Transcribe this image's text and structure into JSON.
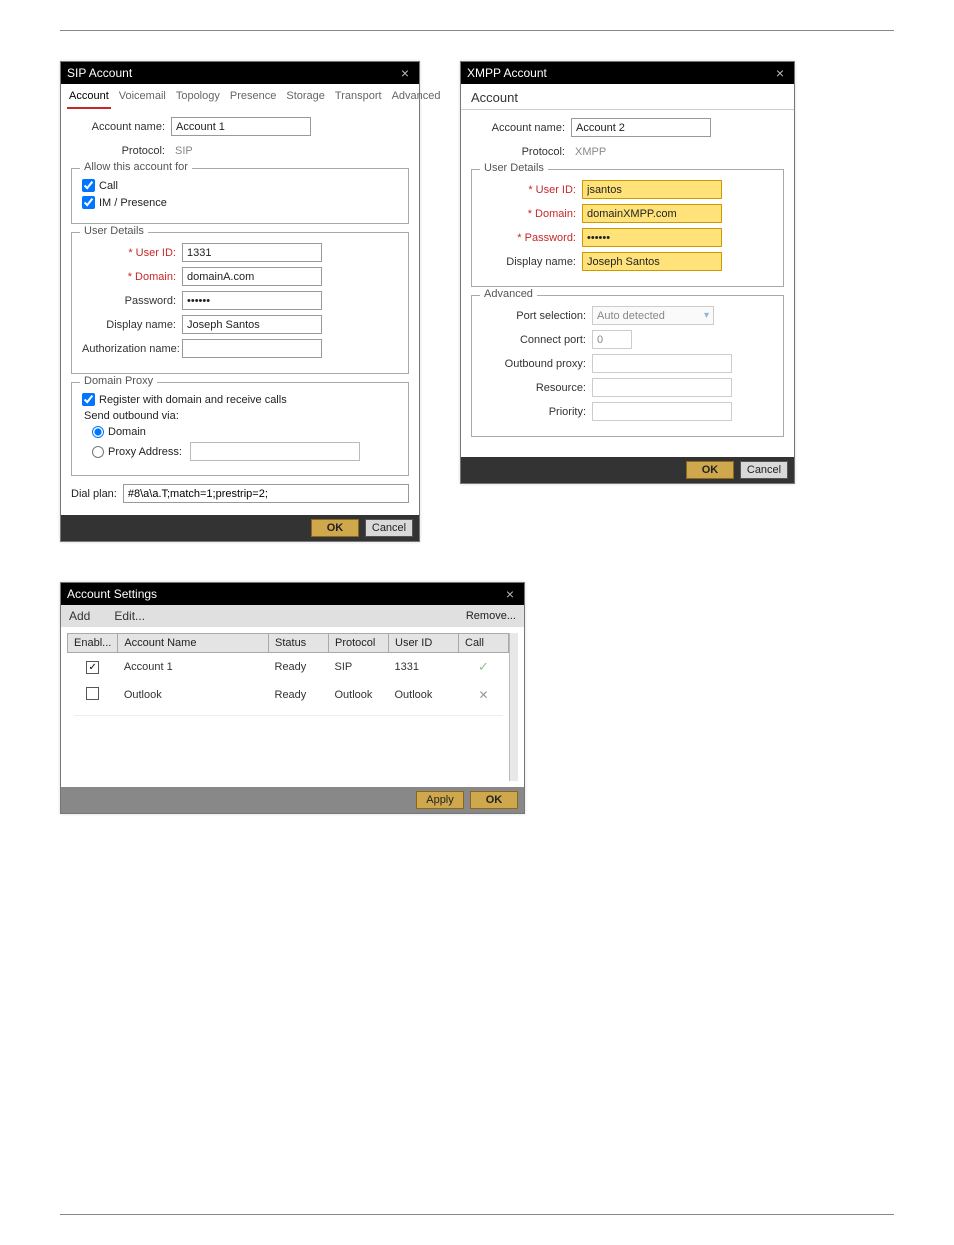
{
  "sip": {
    "title": "SIP Account",
    "tabs": [
      "Account",
      "Voicemail",
      "Topology",
      "Presence",
      "Storage",
      "Transport",
      "Advanced"
    ],
    "account_name_label": "Account name:",
    "account_name": "Account 1",
    "protocol_label": "Protocol:",
    "protocol": "SIP",
    "allow_group": "Allow this account for",
    "allow_call": "Call",
    "allow_im": "IM / Presence",
    "user_details_group": "User Details",
    "user_id_label": "* User ID:",
    "user_id": "1331",
    "domain_label": "* Domain:",
    "domain": "domainA.com",
    "password_label": "Password:",
    "password": "••••••",
    "display_name_label": "Display name:",
    "display_name": "Joseph Santos",
    "auth_name_label": "Authorization name:",
    "auth_name": "",
    "domain_proxy_group": "Domain Proxy",
    "register_label": "Register with domain and receive calls",
    "send_via_label": "Send outbound via:",
    "radio_domain": "Domain",
    "radio_proxy": "Proxy  Address:",
    "dial_plan_label": "Dial plan:",
    "dial_plan": "#8\\a\\a.T;match=1;prestrip=2;",
    "ok": "OK",
    "cancel": "Cancel"
  },
  "xmpp": {
    "title": "XMPP Account",
    "tab": "Account",
    "account_name_label": "Account name:",
    "account_name": "Account 2",
    "protocol_label": "Protocol:",
    "protocol": "XMPP",
    "user_details_group": "User Details",
    "user_id_label": "* User ID:",
    "user_id": "jsantos",
    "domain_label": "* Domain:",
    "domain": "domainXMPP.com",
    "password_label": "* Password:",
    "password": "••••••",
    "display_name_label": "Display name:",
    "display_name": "Joseph Santos",
    "advanced_group": "Advanced",
    "port_selection_label": "Port selection:",
    "port_selection": "Auto detected",
    "connect_port_label": "Connect port:",
    "connect_port": "0",
    "outbound_proxy_label": "Outbound proxy:",
    "resource_label": "Resource:",
    "priority_label": "Priority:",
    "ok": "OK",
    "cancel": "Cancel"
  },
  "accounts": {
    "title": "Account Settings",
    "menu_add": "Add",
    "menu_edit": "Edit...",
    "menu_remove": "Remove...",
    "col_enabled": "Enabl...",
    "col_name": "Account Name",
    "col_status": "Status",
    "col_protocol": "Protocol",
    "col_userid": "User ID",
    "col_call": "Call",
    "rows": [
      {
        "enabled": true,
        "name": "Account 1",
        "status": "Ready",
        "protocol": "SIP",
        "userid": "1331",
        "call": "check"
      },
      {
        "enabled": false,
        "name": "Outlook",
        "status": "Ready",
        "protocol": "Outlook",
        "userid": "Outlook",
        "call": "x"
      }
    ],
    "apply": "Apply",
    "ok": "OK"
  }
}
